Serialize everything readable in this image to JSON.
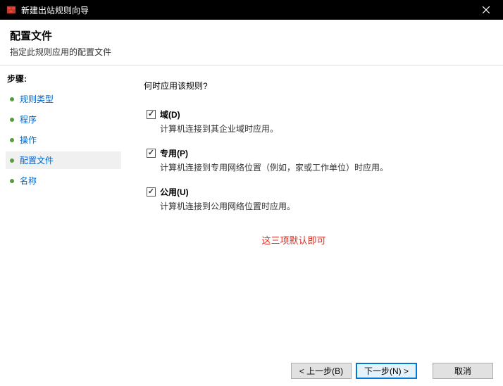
{
  "titlebar": {
    "title": "新建出站规则向导"
  },
  "header": {
    "title": "配置文件",
    "subtitle": "指定此规则应用的配置文件"
  },
  "sidebar": {
    "heading": "步骤:",
    "items": [
      {
        "label": "规则类型"
      },
      {
        "label": "程序"
      },
      {
        "label": "操作"
      },
      {
        "label": "配置文件"
      },
      {
        "label": "名称"
      }
    ]
  },
  "main": {
    "question": "何时应用该规则?",
    "checkboxes": [
      {
        "label": "域(D)",
        "desc": "计算机连接到其企业域时应用。",
        "checked": true
      },
      {
        "label": "专用(P)",
        "desc": "计算机连接到专用网络位置（例如，家或工作单位）时应用。",
        "checked": true
      },
      {
        "label": "公用(U)",
        "desc": "计算机连接到公用网络位置时应用。",
        "checked": true
      }
    ],
    "note": "这三项默认即可"
  },
  "footer": {
    "back": "< 上一步(B)",
    "next": "下一步(N) >",
    "cancel": "取消"
  }
}
